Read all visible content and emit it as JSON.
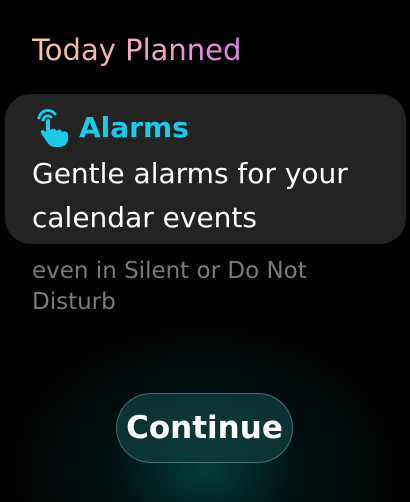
{
  "header": {
    "title": "Today Planned"
  },
  "card": {
    "icon": "hand-tap-icon",
    "label": "Alarms",
    "body": "Gentle alarms for your calendar events"
  },
  "continuation": {
    "text": "even in Silent or Do Not Disturb"
  },
  "actions": {
    "continue_label": "Continue"
  },
  "colors": {
    "title_gradient": [
      "#f5c6a2",
      "#f2a6c6",
      "#e07ee8"
    ],
    "accent": "#1ec8e6",
    "card_bg": "#232323",
    "button_bg": "#0e3a38",
    "muted_text": "#7a7a7a"
  }
}
